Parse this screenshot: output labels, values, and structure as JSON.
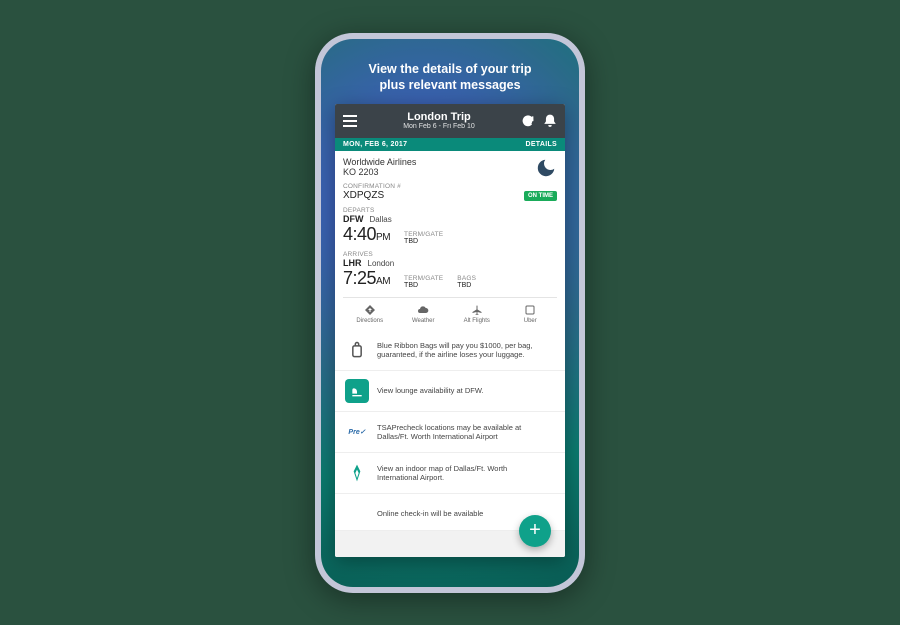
{
  "promo": {
    "line1": "View the details of your trip",
    "line2": "plus relevant messages"
  },
  "header": {
    "title": "London Trip",
    "subtitle": "Mon Feb 6 - Fri Feb 10"
  },
  "datebar": {
    "date": "MON, FEB 6, 2017",
    "details": "DETAILS"
  },
  "flight": {
    "airline": "Worldwide Airlines",
    "number": "KO 2203",
    "conf_label": "CONFIRMATION #",
    "conf_value": "XDPQZS",
    "status_badge": "ON TIME",
    "depart": {
      "label": "DEPARTS",
      "code": "DFW",
      "city": "Dallas",
      "time": "4:40",
      "ampm": "PM",
      "tg_label": "TERM/GATE",
      "tg_value": "TBD"
    },
    "arrive": {
      "label": "ARRIVES",
      "code": "LHR",
      "city": "London",
      "time": "7:25",
      "ampm": "AM",
      "tg_label": "TERM/GATE",
      "tg_value": "TBD",
      "bags_label": "BAGS",
      "bags_value": "TBD"
    }
  },
  "actions": {
    "directions": "Directions",
    "weather": "Weather",
    "altflights": "Alt Flights",
    "uber": "Uber"
  },
  "messages": [
    {
      "icon": "luggage",
      "text": "Blue Ribbon Bags will pay you $1000, per bag, guaranteed, if the airline loses your luggage."
    },
    {
      "icon": "lounge",
      "text": "View lounge availability at DFW."
    },
    {
      "icon": "precheck",
      "text": "TSAPrecheck locations may be available at Dallas/Ft. Worth International Airport"
    },
    {
      "icon": "map",
      "text": "View an indoor map of Dallas/Ft. Worth International Airport."
    },
    {
      "icon": "checkin",
      "text": "Online check-in will be available"
    }
  ],
  "colors": {
    "accent": "#0fa18a",
    "header": "#3b4349",
    "badge": "#1aab5a"
  }
}
